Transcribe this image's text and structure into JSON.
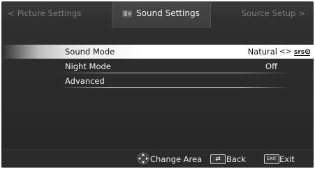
{
  "header": {
    "left_tab": "< Picture Settings",
    "center_title": "Sound Settings",
    "right_tab": "Source Setup >"
  },
  "menu": {
    "items": [
      {
        "label": "Sound Mode",
        "value": "Natural",
        "arrows": "<>",
        "badge": "srs",
        "selected": true
      },
      {
        "label": "Night Mode",
        "value": "Off",
        "selected": false
      },
      {
        "label": "Advanced",
        "value": "",
        "selected": false
      }
    ]
  },
  "footer": {
    "change_area_label": "Change Area",
    "back_label": "Back",
    "exit_key_label": "EXIT",
    "exit_label": "Exit"
  },
  "colors": {
    "background": "#2a2a2a",
    "selected_row": "#ffffff",
    "header_inactive_text": "#7d7d7d"
  }
}
